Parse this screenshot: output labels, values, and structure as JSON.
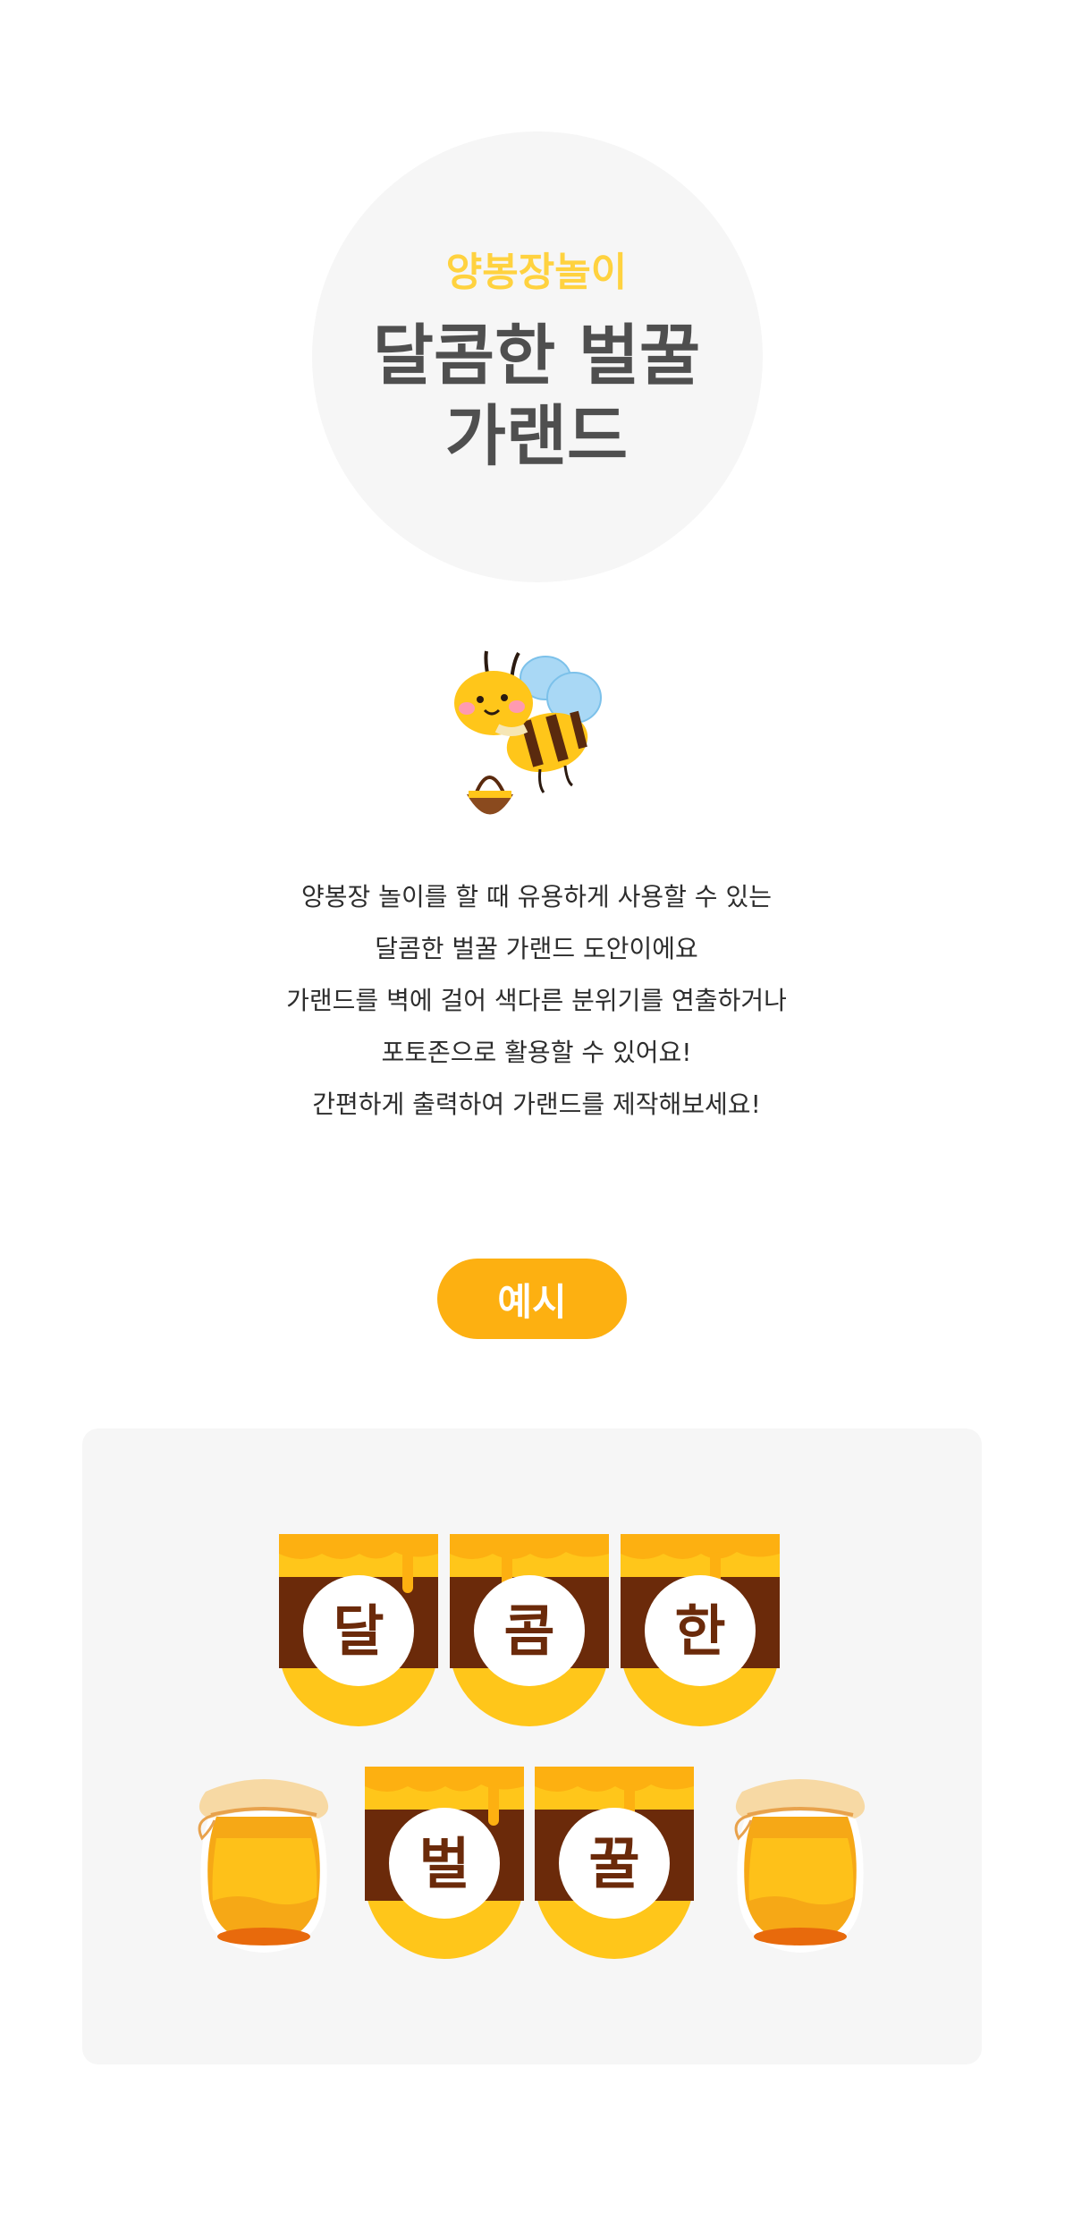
{
  "hero": {
    "eyebrow": "양봉장놀이",
    "title_lines": [
      "달콤한 벌꿀",
      "가랜드"
    ]
  },
  "description": {
    "lines": [
      "양봉장 놀이를 할 때 유용하게 사용할 수 있는",
      "달콤한 벌꿀 가랜드 도안이에요",
      "가랜드를 벽에 걸어 색다른 분위기를 연출하거나",
      "포토존으로 활용할 수 있어요!",
      "간편하게 출력하여 가랜드를 제작해보세요!"
    ]
  },
  "example": {
    "label": "예시",
    "row1_letters": [
      "달",
      "콤",
      "한"
    ],
    "row2_letters": [
      "벌",
      "꿀"
    ]
  },
  "colors": {
    "accent": "#fdb011",
    "eyebrow": "#ffd23f",
    "title": "#4f4f4f",
    "honey_brown": "#6b2a0a",
    "honey_yellow": "#ffc61a"
  },
  "icons": {
    "mascot": "bee-icon",
    "decoration": "honey-jar-icon"
  }
}
